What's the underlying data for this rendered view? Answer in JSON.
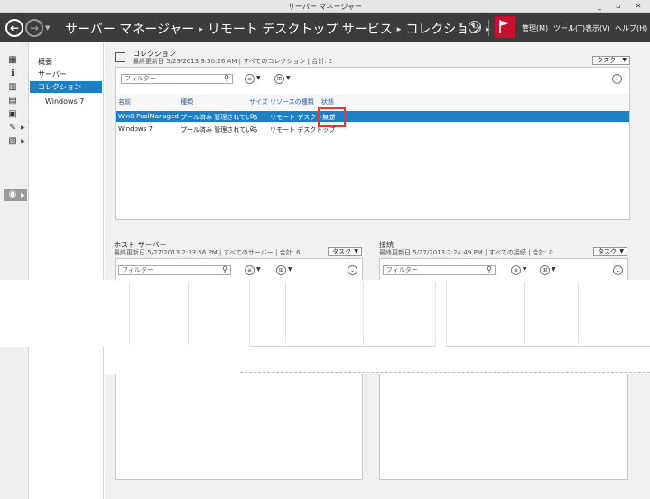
{
  "window": {
    "title": "サーバー マネージャー",
    "controls": [
      "_",
      "▫",
      "✕"
    ]
  },
  "nav": {
    "breadcrumb": [
      "サーバー マネージャー",
      "リモート デスクトップ サービス",
      "コレクション"
    ],
    "menus": [
      "管理(M)",
      "ツール(T)",
      "表示(V)",
      "ヘルプ(H)"
    ],
    "flag_color": "#c8102e",
    "bar_color": "#3c3c3c"
  },
  "sidebar": {
    "items": [
      {
        "label": "概要"
      },
      {
        "label": "サーバー"
      },
      {
        "label": "コレクション"
      },
      {
        "label": "Windows 7"
      }
    ],
    "selected_color": "#1f7fc4"
  },
  "collections": {
    "title": "コレクション",
    "subtitle": "最終更新日 5/29/2013 9:50:26 AM | すべてのコレクション | 合計: 2",
    "task_label": "タスク",
    "filter_placeholder": "フィルター",
    "columns": [
      "名前",
      "種類",
      "サイズ",
      "リソースの種類",
      "状態"
    ],
    "rows": [
      {
        "name": "Win8-PoolManaged",
        "type": "プール済み 管理されている",
        "size": "0",
        "resource": "リモート デスクトップ",
        "status": "無効"
      },
      {
        "name": "Windows 7",
        "type": "プール済み 管理されている",
        "size": "2",
        "resource": "リモート デスクトップ",
        "status": ""
      }
    ]
  },
  "hosts": {
    "title": "ホスト サーバー",
    "subtitle": "最終更新日 5/27/2013 2:33:56 PM | すべてのサーバー | 合計: 6",
    "task_label": "タスク",
    "filter_placeholder": "フィルター"
  },
  "connections": {
    "title": "接続",
    "subtitle": "最終更新日 5/27/2013 2:24:49 PM | すべての接続 | 合計: 0",
    "task_label": "タスク",
    "filter_placeholder": "フィルター"
  }
}
